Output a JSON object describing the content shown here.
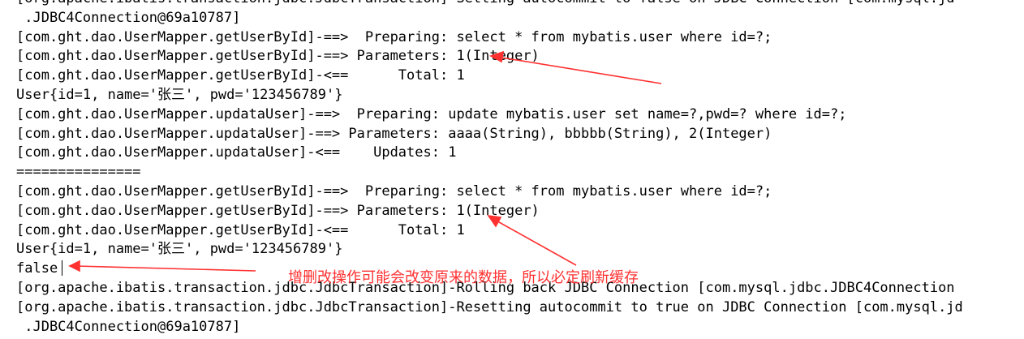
{
  "console": {
    "lines": [
      "[org.apache.ibatis.transaction.jdbc.JdbcTransaction]-Setting autocommit to false on JDBC Connection [com.mysql.jd",
      " .JDBC4Connection@69a10787]",
      "[com.ght.dao.UserMapper.getUserById]-==>  Preparing: select * from mybatis.user where id=?;",
      "[com.ght.dao.UserMapper.getUserById]-==> Parameters: 1(Integer)",
      "[com.ght.dao.UserMapper.getUserById]-<==      Total: 1",
      "User{id=1, name='张三', pwd='123456789'}",
      "[com.ght.dao.UserMapper.updataUser]-==>  Preparing: update mybatis.user set name=?,pwd=? where id=?;",
      "[com.ght.dao.UserMapper.updataUser]-==> Parameters: aaaa(String), bbbbb(String), 2(Integer)",
      "[com.ght.dao.UserMapper.updataUser]-<==    Updates: 1",
      "===============",
      "[com.ght.dao.UserMapper.getUserById]-==>  Preparing: select * from mybatis.user where id=?;",
      "[com.ght.dao.UserMapper.getUserById]-==> Parameters: 1(Integer)",
      "[com.ght.dao.UserMapper.getUserById]-<==      Total: 1",
      "User{id=1, name='张三', pwd='123456789'}",
      "false",
      "[org.apache.ibatis.transaction.jdbc.JdbcTransaction]-Rolling back JDBC Connection [com.mysql.jdbc.JDBC4Connection",
      "[org.apache.ibatis.transaction.jdbc.JdbcTransaction]-Resetting autocommit to true on JDBC Connection [com.mysql.jd",
      " .JDBC4Connection@69a10787]"
    ]
  },
  "annotation": {
    "text": "增删改操作可能会改变原来的数据，所以必定刷新缓存",
    "color": "#ff3030"
  }
}
